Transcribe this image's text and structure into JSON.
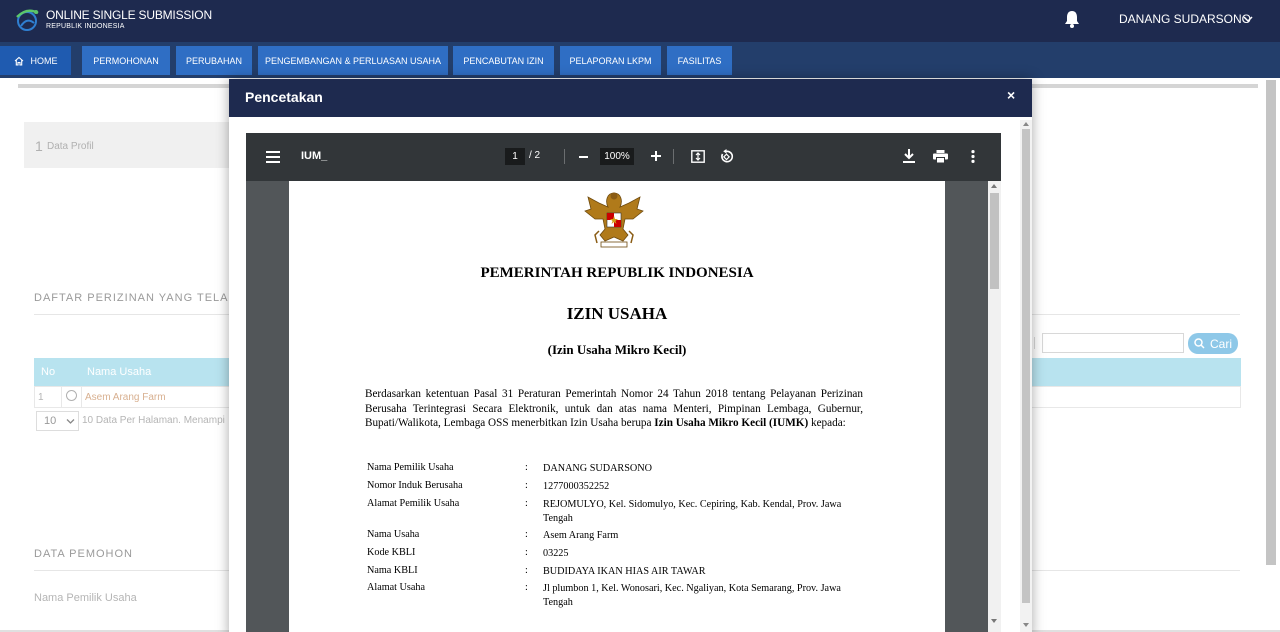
{
  "brand": {
    "title": "ONLINE SINGLE SUBMISSION",
    "subtitle": "REPUBLIK INDONESIA"
  },
  "header": {
    "user_name": "DANANG SUDARSONO",
    "icons": [
      "bell-icon",
      "chevron-down-icon"
    ]
  },
  "nav": {
    "home": "HOME",
    "items": [
      "PERMOHONAN",
      "PERUBAHAN",
      "PENGEMBANGAN & PERLUASAN USAHA",
      "PENCABUTAN IZIN",
      "PELAPORAN LKPM",
      "FASILITAS"
    ]
  },
  "background_page": {
    "profile_step_number": "1",
    "profile_step_label": "Data Profil",
    "list_heading": "DAFTAR PERIZINAN YANG TELAH",
    "search_button": "Cari",
    "table": {
      "headers": [
        "No",
        "Nama Usaha"
      ],
      "rows": [
        [
          "1",
          "Asem Arang Farm"
        ]
      ]
    },
    "per_page_value": "10",
    "per_page_text": "10 Data Per Halaman. Menampi",
    "applicant_heading": "DATA PEMOHON",
    "applicant_field": "Nama Pemilik Usaha"
  },
  "modal": {
    "title": "Pencetakan",
    "close": "×"
  },
  "pdf_viewer": {
    "filename": "IUM_",
    "current_page": "1",
    "page_total": "/ 2",
    "zoom": "100%"
  },
  "document": {
    "government": "PEMERINTAH REPUBLIK INDONESIA",
    "title": "IZIN USAHA",
    "subtitle": "(Izin Usaha Mikro Kecil)",
    "body_prefix": "Berdasarkan ketentuan Pasal 31 Peraturan Pemerintah Nomor 24 Tahun 2018 tentang Pelayanan Perizinan Berusaha Terintegrasi Secara Elektronik, untuk dan atas nama Menteri, Pimpinan Lembaga, Gubernur, Bupati/Walikota, Lembaga OSS menerbitkan Izin Usaha berupa ",
    "body_bold": "Izin Usaha Mikro Kecil (IUMK)",
    "body_suffix": " kepada:",
    "colon": ":",
    "fields": [
      {
        "label": "Nama Pemilik Usaha",
        "value": "DANANG SUDARSONO"
      },
      {
        "label": "Nomor Induk Berusaha",
        "value": "1277000352252"
      },
      {
        "label": "Alamat Pemilik Usaha",
        "value": "REJOMULYO, Kel. Sidomulyo, Kec. Cepiring, Kab. Kendal, Prov. Jawa Tengah"
      },
      {
        "label": "Nama Usaha",
        "value": "Asem Arang Farm"
      },
      {
        "label": "Kode KBLI",
        "value": "03225"
      },
      {
        "label": "Nama KBLI",
        "value": "BUDIDAYA IKAN HIAS AIR TAWAR"
      },
      {
        "label": "Alamat Usaha",
        "value": "Jl plumbon 1, Kel. Wonosari, Kec. Ngaliyan, Kota Semarang, Prov. Jawa Tengah"
      }
    ]
  },
  "colors": {
    "topbar": "#1e2a4f",
    "navbar": "#233e6b",
    "nav_button": "#2f6ec4",
    "pdf_toolbar": "#323639",
    "pdf_background": "#525659",
    "table_header": "#b8e3ef"
  }
}
